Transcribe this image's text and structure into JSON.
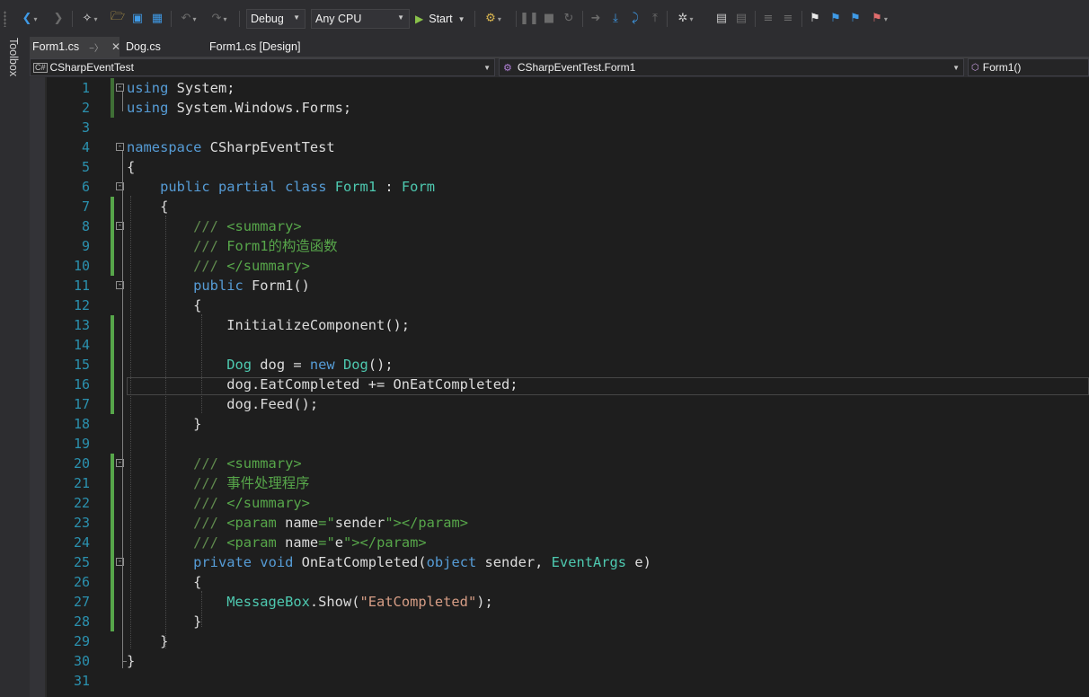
{
  "toolbar": {
    "configuration": "Debug",
    "platform": "Any CPU",
    "start_label": "Start",
    "icons": [
      "back-icon",
      "forward-icon",
      "new-project-icon",
      "open-folder-icon",
      "save-icon",
      "save-all-icon",
      "undo-icon",
      "redo-icon",
      "start-icon",
      "step-into-icon",
      "pause-icon",
      "stop-icon",
      "restart-icon",
      "show-next-statement-icon",
      "step-over-icon",
      "step-out-icon",
      "breakpoint-icon",
      "bookmark-icon"
    ]
  },
  "toolbox": {
    "label": "Toolbox"
  },
  "tabs": [
    {
      "label": "Form1.cs",
      "active": true
    },
    {
      "label": "Dog.cs",
      "active": false
    },
    {
      "label": "Form1.cs [Design]",
      "active": false
    }
  ],
  "navbar": {
    "project": "CSharpEventTest",
    "type": "CSharpEventTest.Form1",
    "member": "Form1()"
  },
  "editor": {
    "lines": [
      {
        "n": "1",
        "seg": [
          [
            "k",
            "using"
          ],
          [
            "p",
            " System;"
          ]
        ]
      },
      {
        "n": "2",
        "seg": [
          [
            "k",
            "using"
          ],
          [
            "p",
            " System.Windows.Forms;"
          ]
        ]
      },
      {
        "n": "3",
        "seg": []
      },
      {
        "n": "4",
        "seg": [
          [
            "k",
            "namespace"
          ],
          [
            "p",
            " CSharpEventTest"
          ]
        ]
      },
      {
        "n": "5",
        "seg": [
          [
            "p",
            "{"
          ]
        ]
      },
      {
        "n": "6",
        "seg": [
          [
            "p",
            "    "
          ],
          [
            "k",
            "public"
          ],
          [
            "p",
            " "
          ],
          [
            "k",
            "partial"
          ],
          [
            "p",
            " "
          ],
          [
            "k",
            "class"
          ],
          [
            "p",
            " "
          ],
          [
            "t",
            "Form1"
          ],
          [
            "p",
            " : "
          ],
          [
            "t",
            "Form"
          ]
        ]
      },
      {
        "n": "7",
        "seg": [
          [
            "p",
            "    {"
          ]
        ]
      },
      {
        "n": "8",
        "seg": [
          [
            "p",
            "        "
          ],
          [
            "cx",
            "///"
          ],
          [
            "c",
            " <summary>"
          ]
        ]
      },
      {
        "n": "9",
        "seg": [
          [
            "p",
            "        "
          ],
          [
            "cx",
            "///"
          ],
          [
            "c",
            " Form1的构造函数"
          ]
        ]
      },
      {
        "n": "10",
        "seg": [
          [
            "p",
            "        "
          ],
          [
            "cx",
            "///"
          ],
          [
            "c",
            " </summary>"
          ]
        ]
      },
      {
        "n": "11",
        "seg": [
          [
            "p",
            "        "
          ],
          [
            "k",
            "public"
          ],
          [
            "p",
            " Form1()"
          ]
        ]
      },
      {
        "n": "12",
        "seg": [
          [
            "p",
            "        {"
          ]
        ]
      },
      {
        "n": "13",
        "seg": [
          [
            "p",
            "            InitializeComponent();"
          ]
        ]
      },
      {
        "n": "14",
        "seg": []
      },
      {
        "n": "15",
        "seg": [
          [
            "p",
            "            "
          ],
          [
            "t",
            "Dog"
          ],
          [
            "p",
            " dog = "
          ],
          [
            "k",
            "new"
          ],
          [
            "p",
            " "
          ],
          [
            "t",
            "Dog"
          ],
          [
            "p",
            "();"
          ]
        ]
      },
      {
        "n": "16",
        "seg": [
          [
            "p",
            "            dog.EatCompleted += OnEatCompleted;"
          ]
        ]
      },
      {
        "n": "17",
        "seg": [
          [
            "p",
            "            dog.Feed();"
          ]
        ]
      },
      {
        "n": "18",
        "seg": [
          [
            "p",
            "        }"
          ]
        ]
      },
      {
        "n": "19",
        "seg": []
      },
      {
        "n": "20",
        "seg": [
          [
            "p",
            "        "
          ],
          [
            "cx",
            "///"
          ],
          [
            "c",
            " <summary>"
          ]
        ]
      },
      {
        "n": "21",
        "seg": [
          [
            "p",
            "        "
          ],
          [
            "cx",
            "///"
          ],
          [
            "c",
            " 事件处理程序"
          ]
        ]
      },
      {
        "n": "22",
        "seg": [
          [
            "p",
            "        "
          ],
          [
            "cx",
            "///"
          ],
          [
            "c",
            " </summary>"
          ]
        ]
      },
      {
        "n": "23",
        "seg": [
          [
            "p",
            "        "
          ],
          [
            "cx",
            "///"
          ],
          [
            "c",
            " <param "
          ],
          [
            "p",
            "name"
          ],
          [
            "c",
            "=\""
          ],
          [
            "p",
            "sender"
          ],
          [
            "c",
            "\"></param>"
          ]
        ]
      },
      {
        "n": "24",
        "seg": [
          [
            "p",
            "        "
          ],
          [
            "cx",
            "///"
          ],
          [
            "c",
            " <param "
          ],
          [
            "p",
            "name"
          ],
          [
            "c",
            "=\""
          ],
          [
            "p",
            "e"
          ],
          [
            "c",
            "\"></param>"
          ]
        ]
      },
      {
        "n": "25",
        "seg": [
          [
            "p",
            "        "
          ],
          [
            "k",
            "private"
          ],
          [
            "p",
            " "
          ],
          [
            "k",
            "void"
          ],
          [
            "p",
            " OnEatCompleted("
          ],
          [
            "k",
            "object"
          ],
          [
            "p",
            " sender, "
          ],
          [
            "t",
            "EventArgs"
          ],
          [
            "p",
            " e)"
          ]
        ]
      },
      {
        "n": "26",
        "seg": [
          [
            "p",
            "        {"
          ]
        ]
      },
      {
        "n": "27",
        "seg": [
          [
            "p",
            "            "
          ],
          [
            "t",
            "MessageBox"
          ],
          [
            "p",
            ".Show("
          ],
          [
            "s",
            "\"EatCompleted\""
          ],
          [
            "p",
            ");"
          ]
        ]
      },
      {
        "n": "28",
        "seg": [
          [
            "p",
            "        }"
          ]
        ]
      },
      {
        "n": "29",
        "seg": [
          [
            "p",
            "    }"
          ]
        ]
      },
      {
        "n": "30",
        "seg": [
          [
            "p",
            "}"
          ]
        ]
      },
      {
        "n": "31",
        "seg": []
      }
    ]
  },
  "colors": {
    "background": "#1e1e1e",
    "keyword": "#569cd6",
    "type": "#4ec9b0",
    "comment": "#57a64a",
    "string": "#d69d85",
    "line_number": "#2b91af",
    "change_bar": "#57a64a"
  }
}
